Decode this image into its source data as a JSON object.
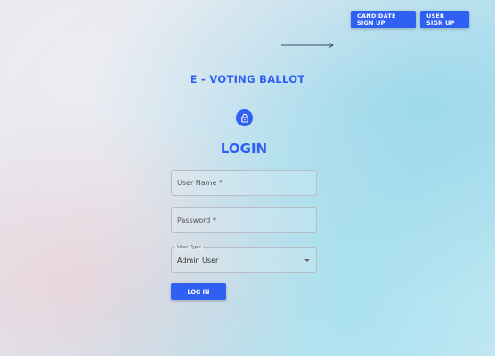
{
  "header": {
    "candidate_signup_label": "CANDIDATE SIGN UP",
    "user_signup_label": "USER SIGN UP"
  },
  "title": "E - VOTING BALLOT",
  "login": {
    "heading": "LOGIN",
    "username_placeholder": "User Name *",
    "password_placeholder": "Password *",
    "user_type_label": "User Type",
    "user_type_value": "Admin User",
    "submit_label": "LOG IN"
  },
  "icons": {
    "arrow": "arrow-right-icon",
    "lock": "lock-icon",
    "select_caret": "caret-down-icon"
  },
  "colors": {
    "accent": "#2f5ff3",
    "field_border": "#b8bcc4"
  }
}
